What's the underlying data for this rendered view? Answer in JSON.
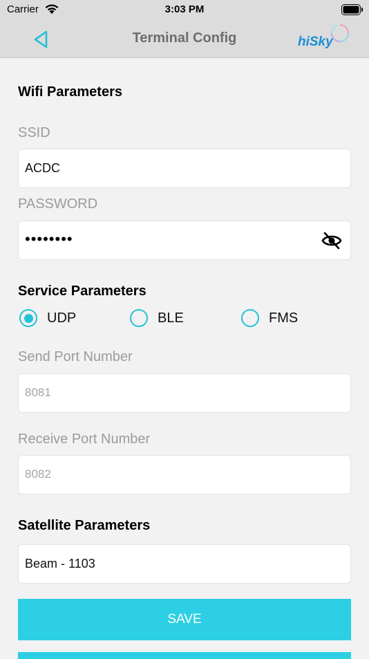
{
  "status": {
    "carrier": "Carrier",
    "time": "3:03 PM"
  },
  "nav": {
    "title": "Terminal Config",
    "logo_text": "hiSky",
    "icons": {
      "back": "back-triangle-icon",
      "logo": "hisky-logo"
    }
  },
  "wifi": {
    "section_title": "Wifi Parameters",
    "ssid_label": "SSID",
    "ssid_value": "ACDC",
    "password_label": "PASSWORD",
    "password_value": "••••••••",
    "icons": {
      "toggle_visibility": "eye-slash-icon"
    }
  },
  "service": {
    "section_title": "Service Parameters",
    "options": [
      {
        "label": "UDP",
        "selected": true
      },
      {
        "label": "BLE",
        "selected": false
      },
      {
        "label": "FMS",
        "selected": false
      }
    ],
    "send_port_label": "Send Port Number",
    "send_port_placeholder": "8081",
    "receive_port_label": "Receive Port Number",
    "receive_port_placeholder": "8082"
  },
  "satellite": {
    "section_title": "Satellite Parameters",
    "beam_value": "Beam - 1103"
  },
  "actions": {
    "save_label": "SAVE"
  },
  "colors": {
    "accent": "#2ccfe3",
    "nav_bg": "#dcdcdc",
    "page_bg": "#f2f2f2",
    "label_gray": "#9b9b9b"
  }
}
